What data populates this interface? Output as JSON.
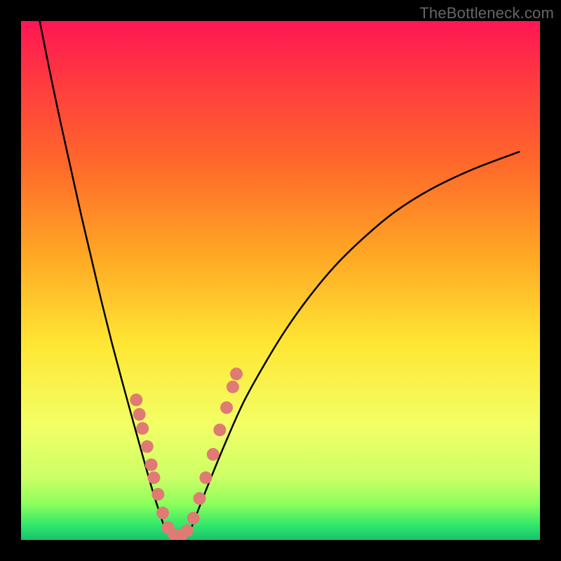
{
  "watermark": "TheBottleneck.com",
  "chart_data": {
    "type": "line",
    "title": "",
    "xlabel": "",
    "ylabel": "",
    "axes_visible": false,
    "grid": false,
    "legend": false,
    "xlim": [
      0,
      1
    ],
    "ylim": [
      0,
      1
    ],
    "background_gradient": {
      "direction": "vertical",
      "stops": [
        {
          "pos": 0.0,
          "color": "#ff1654"
        },
        {
          "pos": 0.12,
          "color": "#ff3b3f"
        },
        {
          "pos": 0.28,
          "color": "#ff6a2a"
        },
        {
          "pos": 0.45,
          "color": "#ffa724"
        },
        {
          "pos": 0.62,
          "color": "#ffe633"
        },
        {
          "pos": 0.78,
          "color": "#f2ff66"
        },
        {
          "pos": 0.88,
          "color": "#ccff66"
        },
        {
          "pos": 0.93,
          "color": "#8eff5c"
        },
        {
          "pos": 0.97,
          "color": "#34e86a"
        },
        {
          "pos": 1.0,
          "color": "#16c26e"
        }
      ]
    },
    "series": [
      {
        "name": "left-branch",
        "stroke": "#000000",
        "stroke_width": 2.5,
        "fill": "none",
        "x": [
          0.036,
          0.055,
          0.075,
          0.095,
          0.115,
          0.135,
          0.155,
          0.175,
          0.195,
          0.215,
          0.235,
          0.255,
          0.275
        ],
        "y": [
          1.0,
          0.905,
          0.81,
          0.72,
          0.63,
          0.545,
          0.46,
          0.38,
          0.305,
          0.232,
          0.16,
          0.09,
          0.028
        ]
      },
      {
        "name": "right-branch",
        "stroke": "#000000",
        "stroke_width": 2.5,
        "fill": "none",
        "x": [
          0.33,
          0.36,
          0.395,
          0.43,
          0.47,
          0.51,
          0.555,
          0.605,
          0.66,
          0.72,
          0.79,
          0.87,
          0.96
        ],
        "y": [
          0.028,
          0.105,
          0.19,
          0.268,
          0.34,
          0.405,
          0.468,
          0.528,
          0.582,
          0.632,
          0.676,
          0.714,
          0.748
        ]
      },
      {
        "name": "bottom-flat",
        "stroke": "#000000",
        "stroke_width": 2.5,
        "fill": "none",
        "x": [
          0.275,
          0.29,
          0.305,
          0.32,
          0.33
        ],
        "y": [
          0.028,
          0.013,
          0.008,
          0.013,
          0.028
        ]
      }
    ],
    "markers": [
      {
        "name": "salmon-dots",
        "color": "#e07a74",
        "radius": 9,
        "points": [
          {
            "x": 0.222,
            "y": 0.27
          },
          {
            "x": 0.228,
            "y": 0.242
          },
          {
            "x": 0.234,
            "y": 0.215
          },
          {
            "x": 0.243,
            "y": 0.18
          },
          {
            "x": 0.251,
            "y": 0.145
          },
          {
            "x": 0.256,
            "y": 0.12
          },
          {
            "x": 0.264,
            "y": 0.088
          },
          {
            "x": 0.273,
            "y": 0.052
          },
          {
            "x": 0.283,
            "y": 0.024
          },
          {
            "x": 0.295,
            "y": 0.01
          },
          {
            "x": 0.308,
            "y": 0.008
          },
          {
            "x": 0.32,
            "y": 0.018
          },
          {
            "x": 0.332,
            "y": 0.042
          },
          {
            "x": 0.344,
            "y": 0.08
          },
          {
            "x": 0.356,
            "y": 0.12
          },
          {
            "x": 0.37,
            "y": 0.165
          },
          {
            "x": 0.383,
            "y": 0.212
          },
          {
            "x": 0.396,
            "y": 0.255
          },
          {
            "x": 0.408,
            "y": 0.295
          },
          {
            "x": 0.415,
            "y": 0.32
          }
        ]
      }
    ],
    "colors": {
      "curve": "#000000",
      "marker": "#e07a74",
      "frame": "#000000"
    }
  }
}
